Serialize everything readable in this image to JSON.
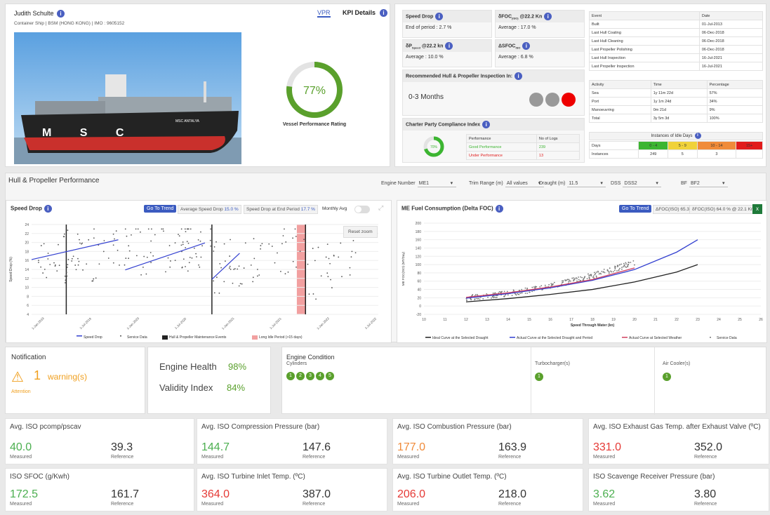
{
  "vessel": {
    "name": "Judith Schulte",
    "sub": "Container Ship | BSM (HONG KONG) | IMO : 9605152",
    "hull_text": "M S C",
    "bow_name": "MSC ANTALYA"
  },
  "vpr": {
    "tab1": "VPR",
    "tab2": "KPI Details",
    "percent": "77%",
    "value": 0.77,
    "label": "Vessel Performance Rating"
  },
  "kpi": {
    "speed_drop": {
      "title": "Speed Drop",
      "value": "End of period : 2.7 %"
    },
    "dfoc": {
      "title": "δFOC",
      "sub": "(ISO)",
      "title2": " @22.2 Kn",
      "value": "Average : 17.0 %"
    },
    "dp": {
      "title": "δP",
      "sub": "Speed",
      "title2": " @22.2 kn",
      "value": "Average : 10.0 %"
    },
    "dsfoc": {
      "title": "ΔSFOC",
      "sub": "ISO",
      "value": "Average : 6.8 %"
    },
    "recommend": {
      "title": "Recommended Hull & Propeller Inspection In:",
      "value": "0-3 Months"
    },
    "charter": {
      "title": "Charter Party Compliance Index",
      "gauge": "70%",
      "h1": "Performance",
      "h2": "No of Logs",
      "rows": [
        [
          "Good Performance",
          "239"
        ],
        [
          "Under Performance",
          "13"
        ]
      ]
    }
  },
  "events": {
    "headers": [
      "Event",
      "Date"
    ],
    "rows": [
      [
        "Built",
        "01-Jul-2013"
      ],
      [
        "Last Hull Coating",
        "06-Dec-2018"
      ],
      [
        "Last Hull Cleaning",
        "06-Dec-2018"
      ],
      [
        "Last Propeller Polishing",
        "06-Dec-2018"
      ],
      [
        "Last Hull Inspection",
        "16-Jul-2021"
      ],
      [
        "Last Propeller Inspection",
        "16-Jul-2021"
      ]
    ]
  },
  "activity": {
    "headers": [
      "Activity",
      "Time",
      "Percentage"
    ],
    "rows": [
      [
        "Sea",
        "1y 11m 22d",
        "57%"
      ],
      [
        "Port",
        "1y 1m 24d",
        "34%"
      ],
      [
        "Manoeuvring",
        "0m 21d",
        "9%"
      ],
      [
        "Total",
        "3y 5m 3d",
        "100%"
      ]
    ]
  },
  "idle": {
    "title": "Instances of Idle Days",
    "days_label": "Days",
    "instances_label": "Instances",
    "cols": [
      {
        "d": "0 - 4",
        "n": "249",
        "c": "#3cb531"
      },
      {
        "d": "5 - 9",
        "n": "5",
        "c": "#f0d23a"
      },
      {
        "d": "10 - 14",
        "n": "3",
        "c": "#f08b3a"
      },
      {
        "d": "15+",
        "n": "",
        "c": "#e11c1c"
      }
    ]
  },
  "hp": {
    "title": "Hull & Propeller Performance",
    "filters": [
      {
        "label": "Engine Number",
        "value": "ME1"
      },
      {
        "label": "Trim Range (m)",
        "value": "All values"
      },
      {
        "label": "Draught (m)",
        "value": "11.5"
      },
      {
        "label": "DSS",
        "value": "DSS2"
      },
      {
        "label": "BF",
        "value": "BF2"
      }
    ]
  },
  "sd_chart": {
    "title": "Speed Drop",
    "go": "Go To Trend",
    "avg": "Average Speed Drop",
    "avg_v": "15.0 %",
    "end": "Speed Drop at End Period",
    "end_v": "17.7 %",
    "monthly": "Monthly Avg",
    "reset": "Reset zoom",
    "ylabel": "Speed Drop (%)",
    "legend": [
      "Speed Drop",
      "Service Data",
      "Hull & Propeller Maintenance Events",
      "Long Idle Period (>15 days)"
    ]
  },
  "chart_data": [
    {
      "type": "scatter",
      "ylim": [
        4,
        24
      ],
      "yticks": [
        4,
        6,
        8,
        10,
        12,
        14,
        16,
        18,
        20,
        22,
        24
      ],
      "xlabels": [
        "1-Jan-2019",
        "1-Jul-2019",
        "1-Jan-2020",
        "1-Jul-2020",
        "1-Jan-2021",
        "1-Jul-2021",
        "1-Jan-2022",
        "1-Jul-2022"
      ],
      "trend": [
        [
          0,
          16.2,
          0.25,
          20.6
        ],
        [
          0.27,
          13.9,
          0.5,
          19.9
        ],
        [
          0.52,
          11.8,
          0.6,
          17.6
        ]
      ]
    },
    {
      "type": "line",
      "xlabel": "Speed Through Water (kn)",
      "ylabel": "ME FOC(ISO) (MT/Day)",
      "xlim": [
        10,
        26
      ],
      "ylim": [
        -20,
        200
      ],
      "xticks": [
        10,
        11,
        12,
        13,
        14,
        15,
        16,
        17,
        18,
        19,
        20,
        21,
        22,
        23,
        24,
        25,
        26
      ],
      "yticks": [
        -20,
        0,
        20,
        40,
        60,
        80,
        100,
        120,
        140,
        160,
        180,
        200
      ],
      "series": [
        {
          "name": "Ideal Curve at the Selected Draught",
          "x": [
            12,
            14,
            16,
            18,
            20,
            22,
            23
          ],
          "y": [
            10,
            18,
            28,
            40,
            58,
            82,
            100
          ]
        },
        {
          "name": "Actual Curve at the Selected Draught and Period",
          "x": [
            12,
            14,
            16,
            18,
            20,
            22,
            23
          ],
          "y": [
            19,
            30,
            44,
            62,
            88,
            130,
            160
          ]
        },
        {
          "name": "Actual Curve at Selected Weather",
          "x": [
            12,
            14,
            16,
            18,
            20
          ],
          "y": [
            21,
            32,
            46,
            64,
            92
          ]
        }
      ]
    }
  ],
  "foc_chart": {
    "title": "ME Fuel Consumption (Delta FOC)",
    "go": "Go To Trend",
    "p1": "ΔFOC(ISO) 65.3 %",
    "p2": "δFOC(ISO) 64.0 % @ 22.1 Kn",
    "legend": [
      "Ideal Curve at the Selected Draught",
      "Actual Curve at the Selected Draught and Period",
      "Actual Curve at Selected Weather",
      "Service Data"
    ]
  },
  "notif": {
    "title": "Notification",
    "count": "1",
    "text": "warning(s)",
    "attention": "Attention"
  },
  "health": {
    "eh_label": "Engine Health",
    "eh_value": "98%",
    "vi_label": "Validity Index",
    "vi_value": "84%"
  },
  "engine": {
    "title": "Engine Condition",
    "cyl_label": "Cylinders",
    "cyl": [
      "1",
      "2",
      "3",
      "4",
      "5"
    ],
    "turbo": "Turbocharger(s)",
    "turbo_n": "1",
    "air": "Air Cooler(s)",
    "air_n": "1"
  },
  "metrics": [
    {
      "title": "Avg. ISO pcomp/pscav",
      "m": "40.0",
      "r": "39.3",
      "color": "#4caf50"
    },
    {
      "title": "Avg. ISO Compression Pressure (bar)",
      "m": "144.7",
      "r": "147.6",
      "color": "#4caf50"
    },
    {
      "title": "Avg. ISO Combustion Pressure (bar)",
      "m": "177.0",
      "r": "163.9",
      "color": "#f08b3a"
    },
    {
      "title": "Avg. ISO Exhaust Gas Temp. after Exhaust Valve (ºC)",
      "m": "331.0",
      "r": "352.0",
      "color": "#e53935"
    },
    {
      "title": "ISO SFOC (g/Kwh)",
      "m": "172.5",
      "r": "161.7",
      "color": "#4caf50"
    },
    {
      "title": "Avg. ISO Turbine Inlet Temp. (ºC)",
      "m": "364.0",
      "r": "387.0",
      "color": "#e53935"
    },
    {
      "title": "Avg. ISO Turbine Outlet Temp. (ºC)",
      "m": "206.0",
      "r": "218.0",
      "color": "#e53935"
    },
    {
      "title": "ISO Scavenge Receiver Pressure (bar)",
      "m": "3.62",
      "r": "3.80",
      "color": "#4caf50"
    }
  ],
  "labels": {
    "measured": "Measured",
    "reference": "Reference"
  }
}
